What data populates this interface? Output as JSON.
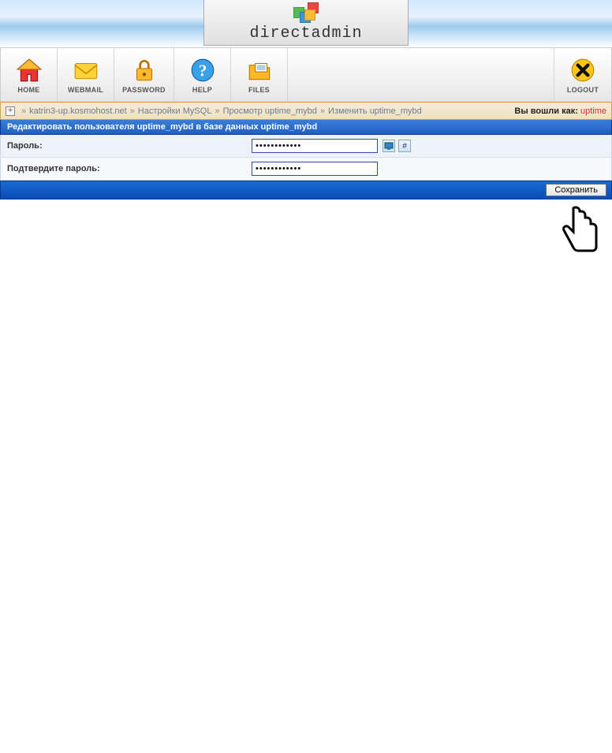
{
  "brand": "directadmin",
  "toolbar": {
    "home": "HOME",
    "webmail": "WEBMAIL",
    "password": "PASSWORD",
    "help": "HELP",
    "files": "FILES",
    "logout": "LOGOUT"
  },
  "breadcrumb": {
    "items": [
      "katrin3-up.kosmohost.net",
      "Настройки MySQL",
      "Просмотр uptime_mybd",
      "Изменить uptime_mybd"
    ],
    "sep": "»"
  },
  "login": {
    "label": "Вы вошли как:",
    "user": "uptime"
  },
  "section_title": "Редактировать пользователя uptime_mybd в базе данных uptime_mybd",
  "form": {
    "password_label": "Пароль:",
    "password_value": "••••••••••••",
    "confirm_label": "Подтвердите пароль:",
    "confirm_value": "••••••••••••",
    "hash_symbol": "#"
  },
  "actions": {
    "save": "Сохранить"
  }
}
